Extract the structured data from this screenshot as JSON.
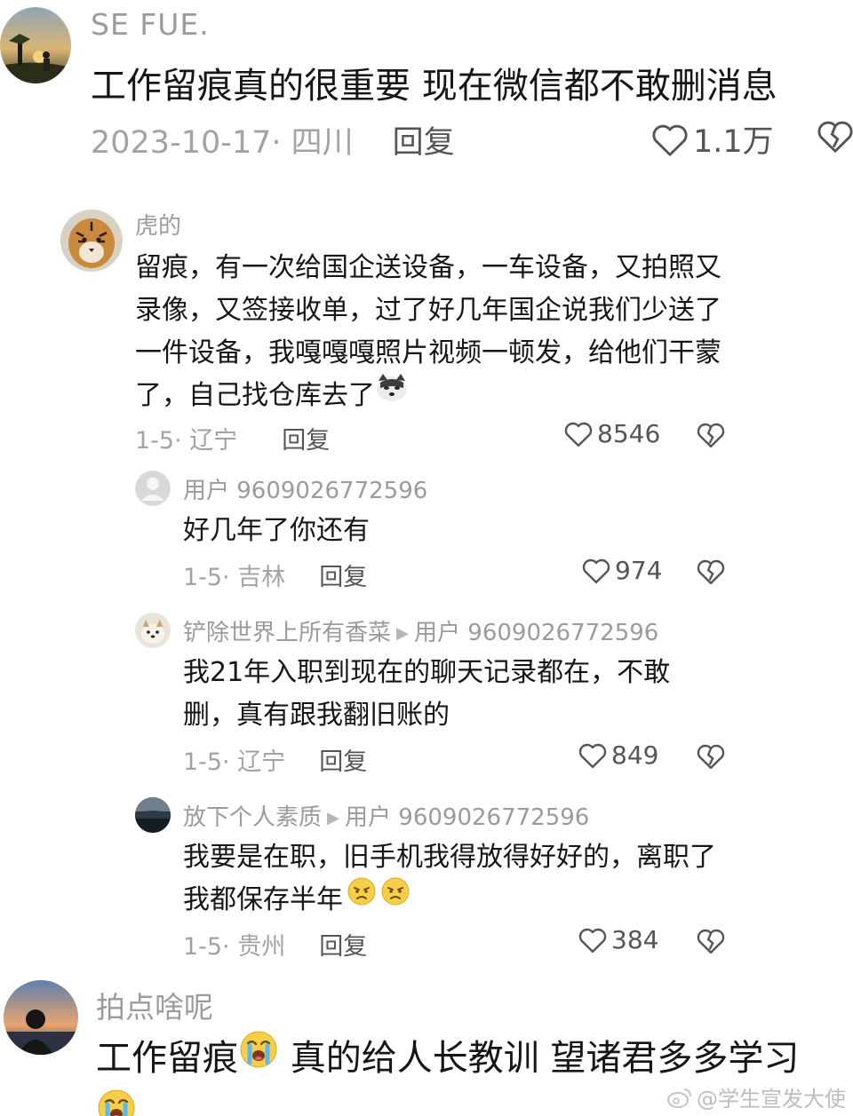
{
  "comments": {
    "c1": {
      "name": "SE FUE.",
      "text": "工作留痕真的很重要   现在微信都不敢删消息",
      "date": "2023-10-17· 四川",
      "reply": "回复",
      "likes": "1.1万",
      "avatar_icon": "avatar-sunset-person"
    },
    "c2": {
      "name": "虎的",
      "text": "留痕，有一次给国企送设备，一车设备，又拍照又录像，又签接收单，过了好几年国企说我们少送了一件设备，我嘎嘎嘎照片视频一顿发，给他们干蒙了，自己找仓库去了",
      "date": "1-5· 辽宁",
      "reply": "回复",
      "likes": "8546",
      "avatar_icon": "avatar-tiger"
    },
    "c3": {
      "name": "用户 9609026772596",
      "text": "好几年了你还有",
      "date": "1-5· 吉林",
      "reply": "回复",
      "likes": "974",
      "avatar_icon": "avatar-default-user"
    },
    "c4": {
      "name": "铲除世界上所有香菜",
      "reply_to": "用户 9609026772596",
      "text": "我21年入职到现在的聊天记录都在，不敢删，真有跟我翻旧账的",
      "date": "1-5· 辽宁",
      "reply": "回复",
      "likes": "849",
      "avatar_icon": "avatar-dog"
    },
    "c5": {
      "name": "放下个人素质",
      "reply_to": "用户 9609026772596",
      "text": "我要是在职，旧手机我得放得好好的，离职了我都保存半年",
      "date": "1-5· 贵州",
      "reply": "回复",
      "likes": "384",
      "avatar_icon": "avatar-dark-landscape"
    },
    "c6": {
      "name": "拍点啥呢",
      "text_part1": "工作留痕",
      "text_part2": " 真的给人长教训 望诸君多多学习",
      "avatar_icon": "avatar-silhouette"
    }
  },
  "watermark": "@学生宣发大使",
  "colors": {
    "text": "#161616",
    "secondary": "#9b9b9b",
    "icon": "#555555"
  }
}
